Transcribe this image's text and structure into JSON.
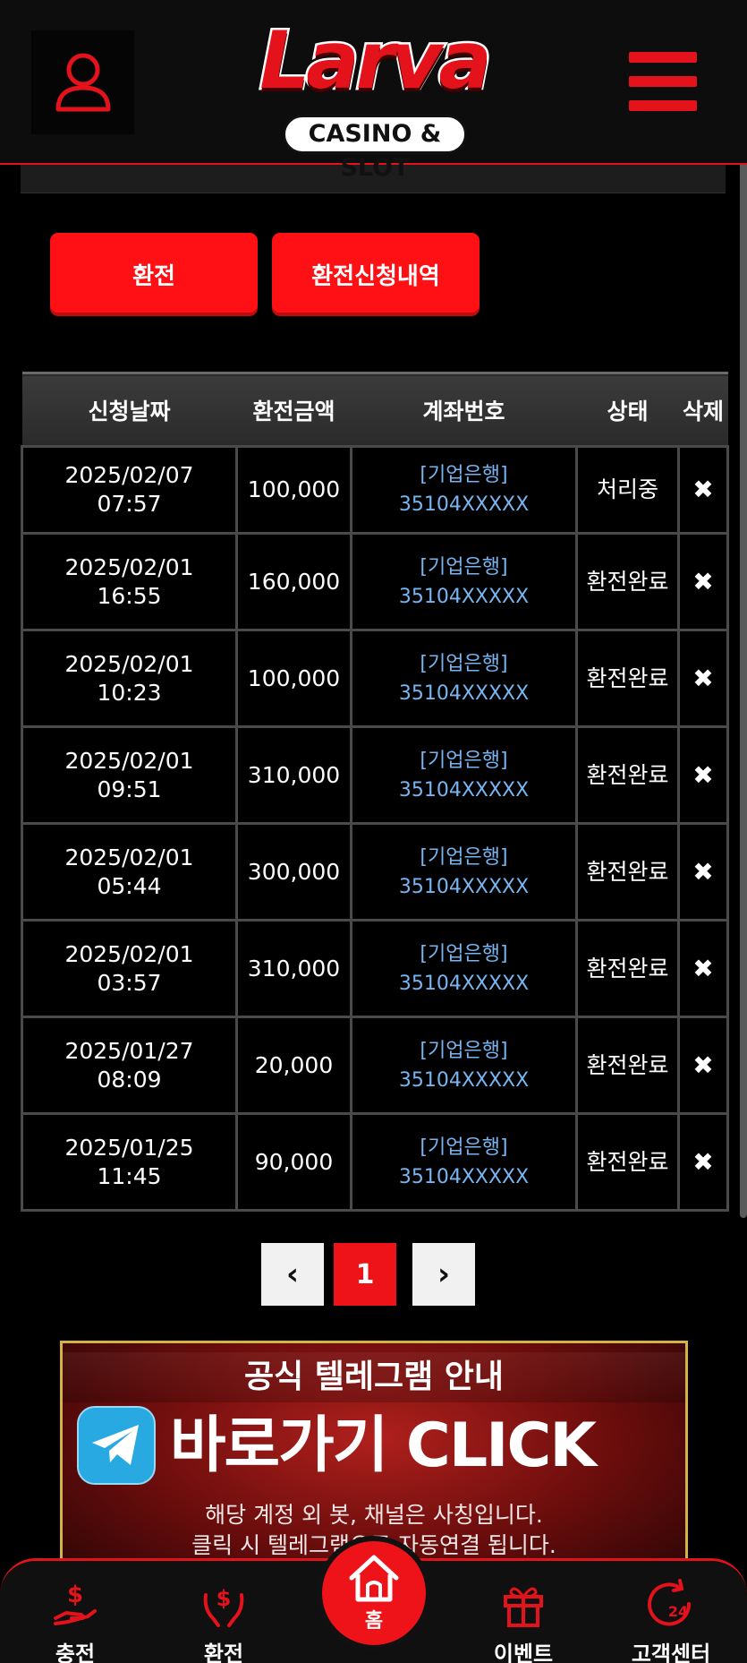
{
  "header": {
    "logo_main": "Larva",
    "logo_sub": "CASINO & SLOT"
  },
  "actions": {
    "exchange_label": "환전",
    "history_label": "환전신청내역"
  },
  "table": {
    "columns": [
      "신청날짜",
      "환전금액",
      "계좌번호",
      "상태",
      "삭제"
    ],
    "rows": [
      {
        "date": "2025/02/07",
        "time": "07:57",
        "amount": "100,000",
        "bank": "[기업은행]",
        "account": "35104XXXXX",
        "status": "처리중",
        "delete": "✖"
      },
      {
        "date": "2025/02/01",
        "time": "16:55",
        "amount": "160,000",
        "bank": "[기업은행]",
        "account": "35104XXXXX",
        "status": "환전완료",
        "delete": "✖"
      },
      {
        "date": "2025/02/01",
        "time": "10:23",
        "amount": "100,000",
        "bank": "[기업은행]",
        "account": "35104XXXXX",
        "status": "환전완료",
        "delete": "✖"
      },
      {
        "date": "2025/02/01",
        "time": "09:51",
        "amount": "310,000",
        "bank": "[기업은행]",
        "account": "35104XXXXX",
        "status": "환전완료",
        "delete": "✖"
      },
      {
        "date": "2025/02/01",
        "time": "05:44",
        "amount": "300,000",
        "bank": "[기업은행]",
        "account": "35104XXXXX",
        "status": "환전완료",
        "delete": "✖"
      },
      {
        "date": "2025/02/01",
        "time": "03:57",
        "amount": "310,000",
        "bank": "[기업은행]",
        "account": "35104XXXXX",
        "status": "환전완료",
        "delete": "✖"
      },
      {
        "date": "2025/01/27",
        "time": "08:09",
        "amount": "20,000",
        "bank": "[기업은행]",
        "account": "35104XXXXX",
        "status": "환전완료",
        "delete": "✖"
      },
      {
        "date": "2025/01/25",
        "time": "11:45",
        "amount": "90,000",
        "bank": "[기업은행]",
        "account": "35104XXXXX",
        "status": "환전완료",
        "delete": "✖"
      }
    ]
  },
  "pagination": {
    "prev": "‹",
    "current": "1",
    "next": "›"
  },
  "banner": {
    "title": "공식 텔레그램 안내",
    "headline": "바로가기 CLICK",
    "line1": "해당 계정 외 봇, 채널은 사칭입니다.",
    "line2": "클릭 시 텔레그램으로 자동연결 됩니다."
  },
  "nav": {
    "deposit": "충전",
    "exchange": "환전",
    "home": "홈",
    "event": "이벤트",
    "support": "고객센터"
  },
  "colors": {
    "accent": "#ee1318",
    "link": "#78b4f0"
  },
  "icons": [
    "user-icon",
    "hamburger-menu-icon",
    "telegram-icon",
    "deposit-icon",
    "exchange-icon",
    "home-icon",
    "gift-icon",
    "support-24-icon"
  ]
}
